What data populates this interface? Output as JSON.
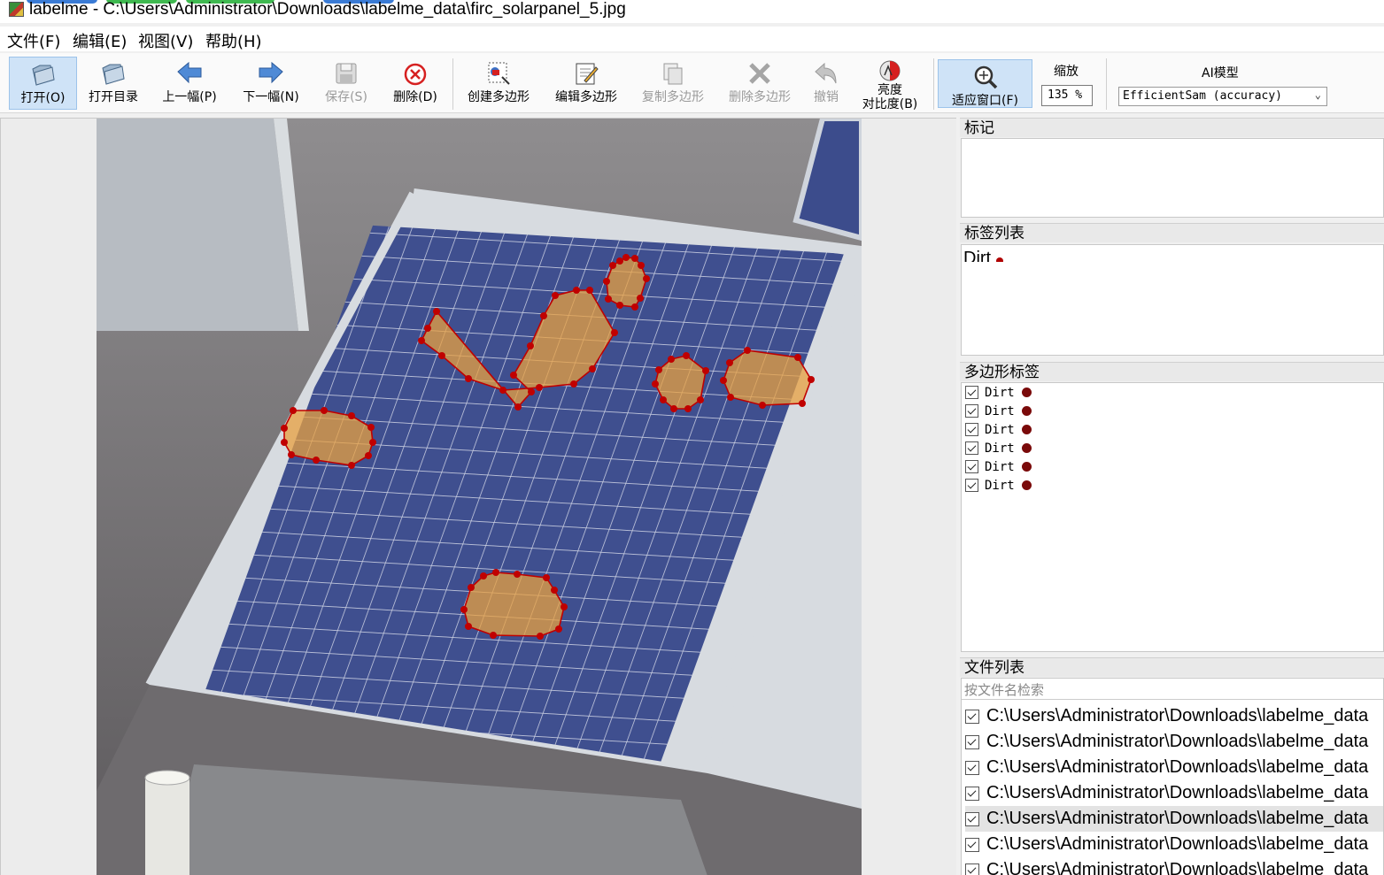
{
  "window": {
    "title": "labelme - C:\\Users\\Administrator\\Downloads\\labelme_data\\firc_solarpanel_5.jpg"
  },
  "menubar": {
    "items": [
      "文件(F)",
      "编辑(E)",
      "视图(V)",
      "帮助(H)"
    ]
  },
  "toolbar": {
    "open": "打开(O)",
    "open_dir": "打开目录",
    "prev": "上一幅(P)",
    "next": "下一幅(N)",
    "save": "保存(S)",
    "delete": "删除(D)",
    "create_polygon": "创建多边形",
    "edit_polygon": "编辑多边形",
    "copy_polygon": "复制多边形",
    "delete_polygon": "删除多边形",
    "undo": "撤销",
    "brightness_line1": "亮度",
    "brightness_line2": "对比度(B)",
    "fit_window": "适应窗口(F)",
    "zoom_label": "缩放",
    "zoom_value": "135 %",
    "ai_label": "AI模型",
    "ai_model": "EfficientSam (accuracy)"
  },
  "docks": {
    "flags_title": "标记",
    "label_list_title": "标签列表",
    "label_list_items": [
      {
        "name": "Dirt",
        "color": "#7a0a0a"
      }
    ],
    "polygon_labels_title": "多边形标签",
    "polygon_labels": [
      "Dirt",
      "Dirt",
      "Dirt",
      "Dirt",
      "Dirt",
      "Dirt"
    ],
    "file_list_title": "文件列表",
    "file_search_placeholder": "按文件名检索",
    "files": [
      "C:\\Users\\Administrator\\Downloads\\labelme_data",
      "C:\\Users\\Administrator\\Downloads\\labelme_data",
      "C:\\Users\\Administrator\\Downloads\\labelme_data",
      "C:\\Users\\Administrator\\Downloads\\labelme_data",
      "C:\\Users\\Administrator\\Downloads\\labelme_data",
      "C:\\Users\\Administrator\\Downloads\\labelme_data",
      "C:\\Users\\Administrator\\Downloads\\labelme_data"
    ],
    "selected_file_index": 4
  },
  "colors": {
    "polygon_stroke": "#c00000",
    "polygon_fill": "#e8a040",
    "label_dot": "#7a0a0a",
    "active_button": "#cfe3f7"
  }
}
